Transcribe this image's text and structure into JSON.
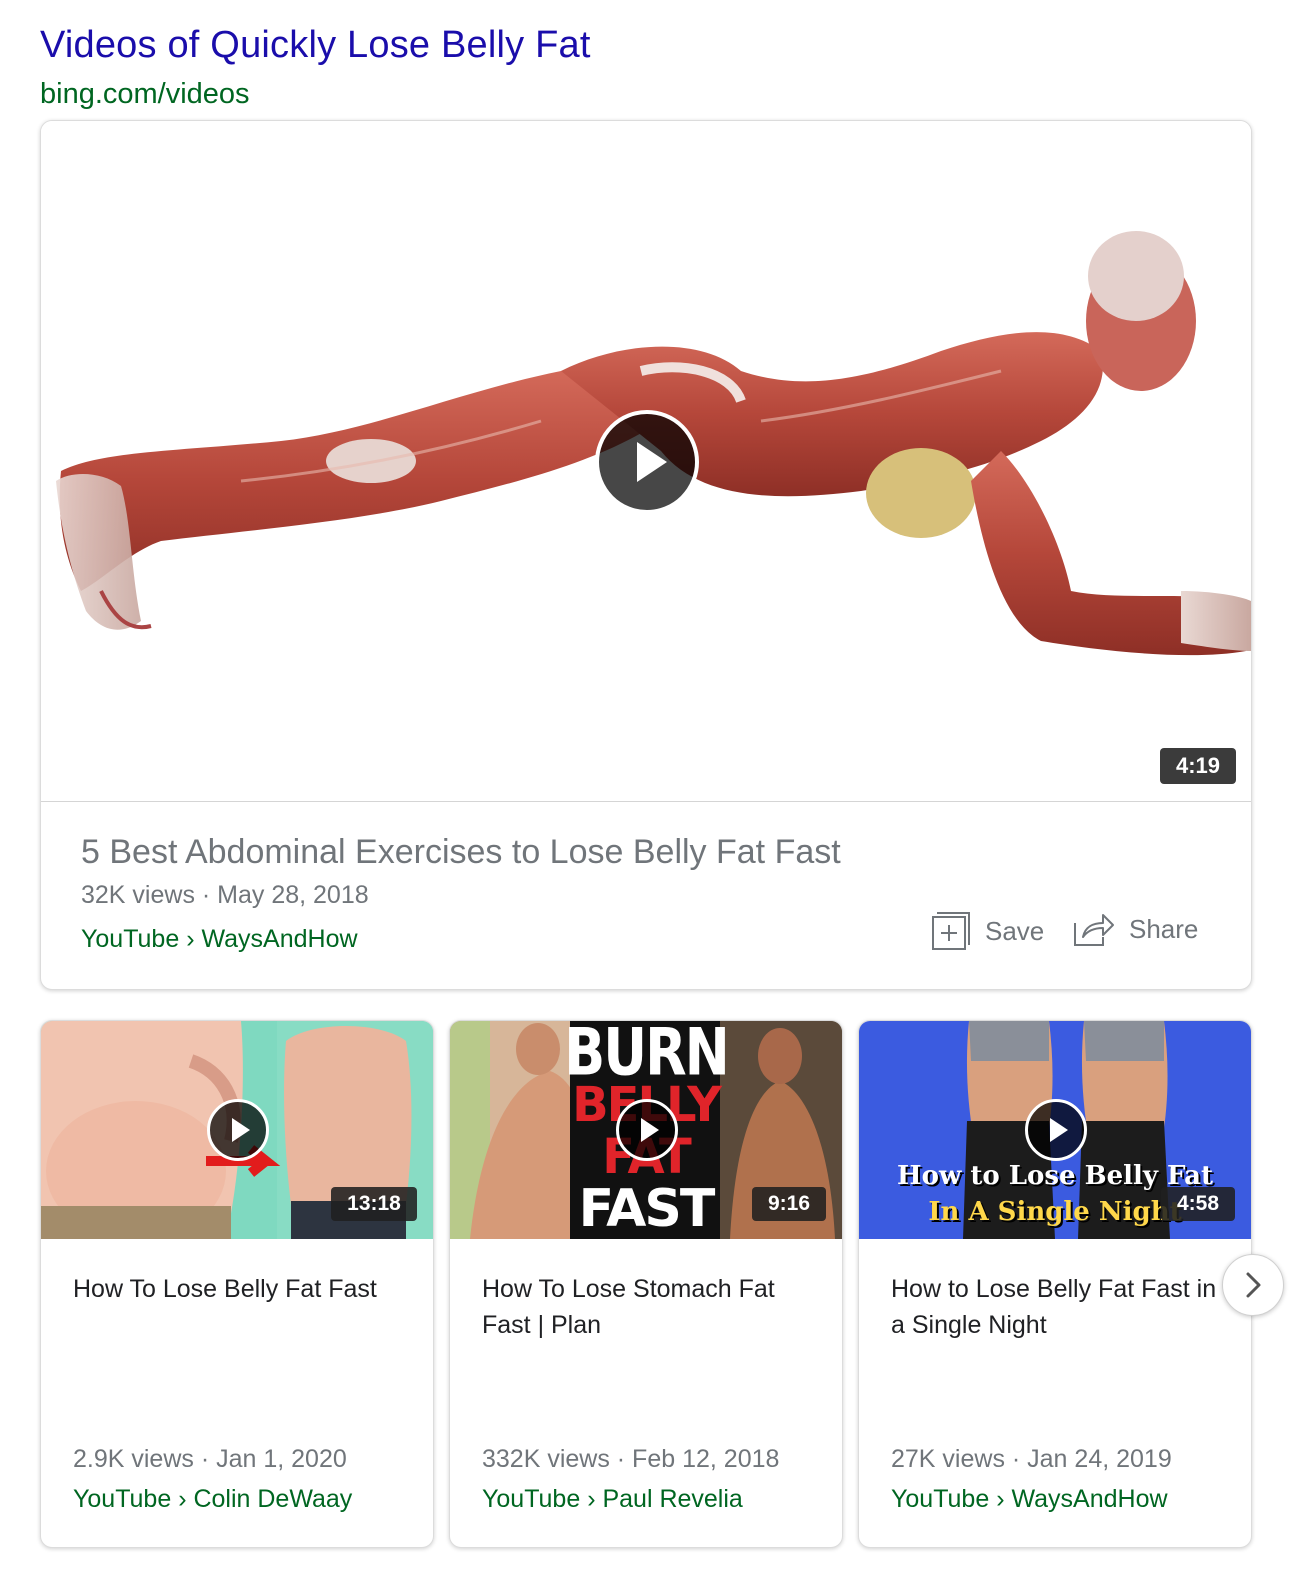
{
  "header": {
    "title": "Videos of Quickly Lose Belly Fat",
    "source": "bing.com/videos"
  },
  "featured": {
    "duration": "4:19",
    "title": "5 Best Abdominal Exercises to Lose Belly Fat Fast",
    "meta": "32K views · May 28, 2018",
    "source": "YouTube › WaysAndHow",
    "save_label": "Save",
    "share_label": "Share",
    "thumbnail": "anatomy-plank-illustration"
  },
  "videos": [
    {
      "duration": "13:18",
      "title": "How To Lose Belly Fat Fast",
      "meta": "2.9K views · Jan 1, 2020",
      "source": "YouTube › Colin DeWaay",
      "thumbnail": "before-after-torso"
    },
    {
      "duration": "9:16",
      "title": "How To Lose Stomach Fat Fast | Plan",
      "meta": "332K views · Feb 12, 2018",
      "source": "YouTube › Paul Revelia",
      "thumbnail": "burn-belly-fat-fast",
      "overlay": [
        "BURN",
        "BELLY",
        "FAT",
        "FAST"
      ]
    },
    {
      "duration": "4:58",
      "title": "How to Lose Belly Fat Fast in a Single Night",
      "meta": "27K views · Jan 24, 2019",
      "source": "YouTube › WaysAndHow",
      "thumbnail": "single-night-belly",
      "overlay": [
        "How to Lose Belly Fat",
        "In A Single Night"
      ]
    }
  ],
  "icons": {
    "play": "play-icon",
    "save": "add-square-icon",
    "share": "share-arrow-icon",
    "next": "chevron-right-icon"
  },
  "colors": {
    "link": "#1a0dab",
    "source": "#006621",
    "meta": "#70757a"
  }
}
